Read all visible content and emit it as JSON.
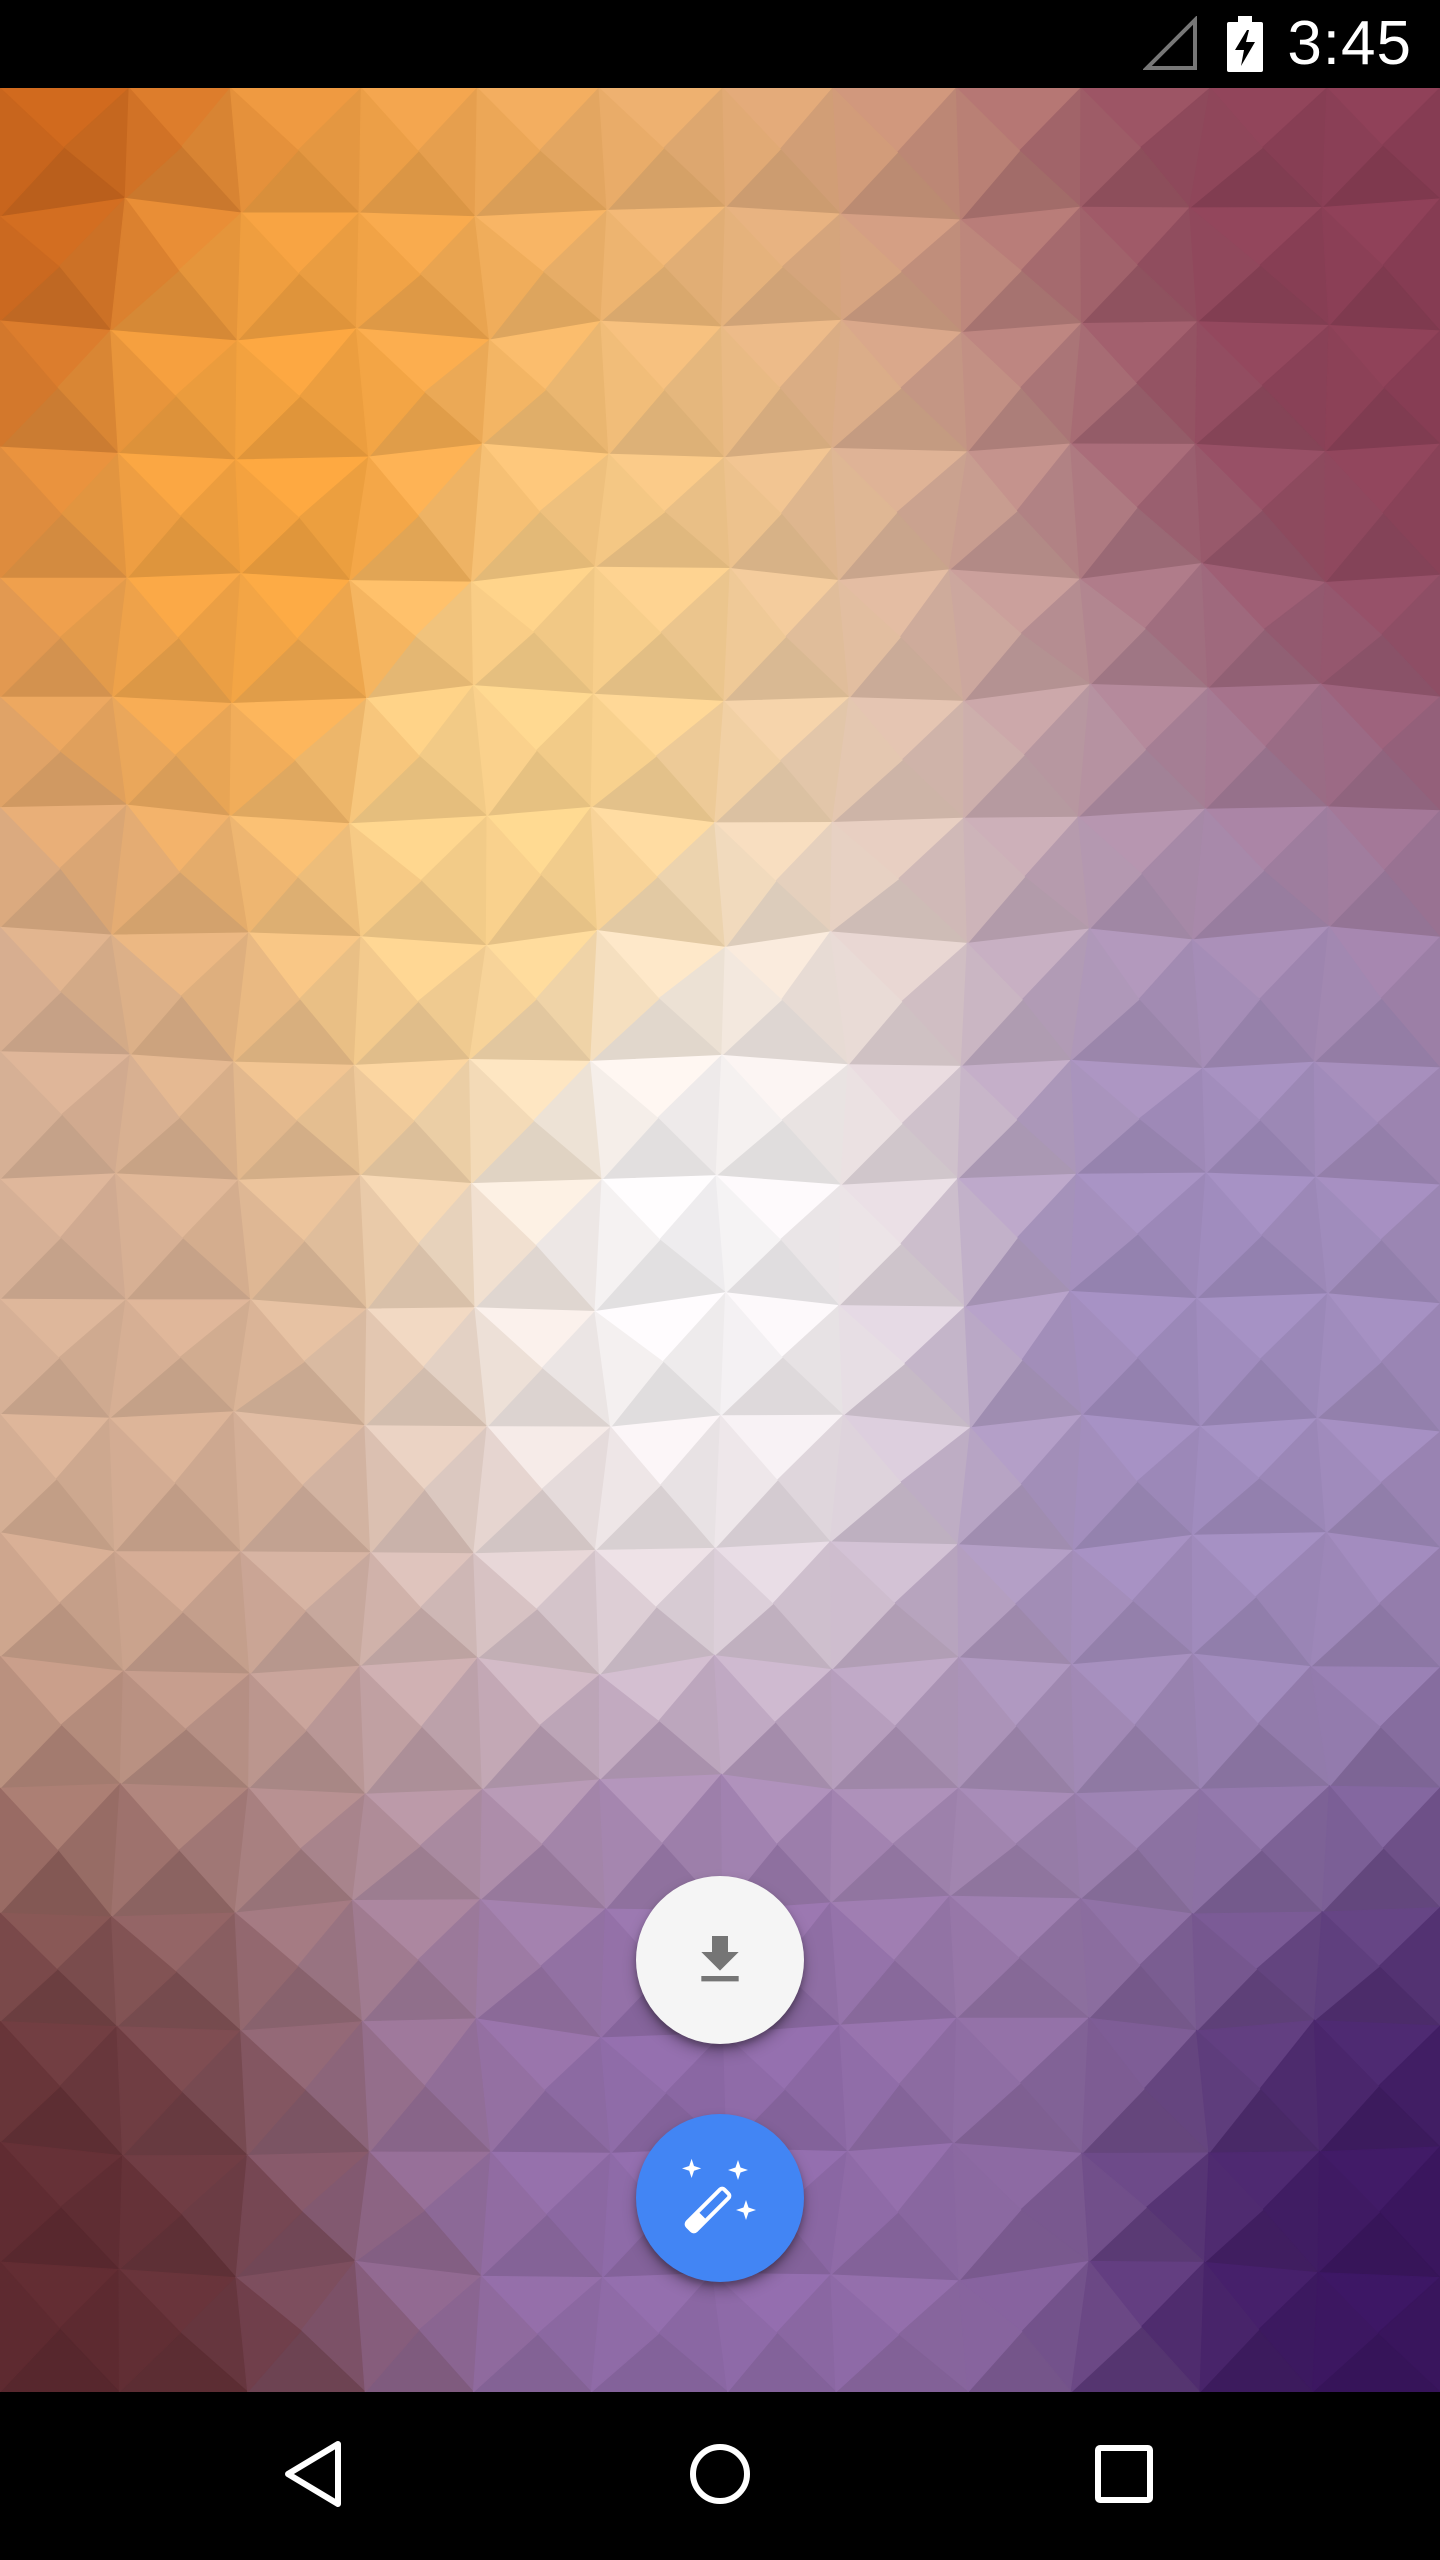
{
  "status_bar": {
    "time": "3:45",
    "icons": [
      "signal-icon",
      "battery-charging-icon"
    ]
  },
  "wallpaper": {
    "style": "low-poly triangle gradient",
    "colors": {
      "top_left": "#c8641c",
      "upper_left": "#f4a23e",
      "center": "#f6f4f6",
      "upper_right": "#8a3e55",
      "lower_right": "#3a1560",
      "bottom_left": "#5e2a30",
      "bottom_center": "#8e6aa8"
    }
  },
  "fabs": {
    "download": {
      "icon": "download-icon",
      "color": "#f5f5f5",
      "icon_color": "#757575"
    },
    "magic": {
      "icon": "magic-wand-icon",
      "color": "#4285f4",
      "icon_color": "#ffffff"
    }
  },
  "nav_bar": {
    "buttons": [
      "back-icon",
      "home-icon",
      "recents-icon"
    ]
  }
}
